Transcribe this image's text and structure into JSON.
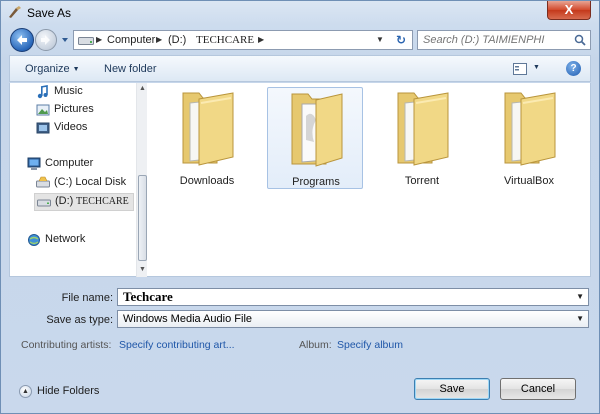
{
  "window": {
    "title": "Save As",
    "close_label": "X"
  },
  "address": {
    "crumbs": [
      "Computer",
      "(D:)",
      "TECHCARE"
    ],
    "search_placeholder": "Search (D:) TAIMIENPHI"
  },
  "toolbar": {
    "organize_label": "Organize",
    "new_folder_label": "New folder",
    "help_label": "?"
  },
  "sidebar": {
    "items": [
      {
        "label": "Music",
        "icon": "music-icon"
      },
      {
        "label": "Pictures",
        "icon": "pictures-icon"
      },
      {
        "label": "Videos",
        "icon": "videos-icon"
      },
      {
        "label": "Computer",
        "icon": "computer-icon"
      },
      {
        "label": "(C:) Local Disk",
        "icon": "drive-icon"
      },
      {
        "label": "(D:)",
        "label_suffix": "TECHCARE",
        "icon": "drive-icon"
      },
      {
        "label": "Network",
        "icon": "network-icon"
      }
    ]
  },
  "folders": [
    {
      "name": "Downloads",
      "selected": false
    },
    {
      "name": "Programs",
      "selected": true
    },
    {
      "name": "Torrent",
      "selected": false
    },
    {
      "name": "VirtualBox",
      "selected": false
    }
  ],
  "form": {
    "filename_label": "File name:",
    "filename_value": "Techcare",
    "savetype_label": "Save as type:",
    "savetype_value": "Windows Media Audio File",
    "artists_label": "Contributing artists:",
    "artists_link": "Specify contributing art...",
    "album_label": "Album:",
    "album_link": "Specify album"
  },
  "footer": {
    "hide_folders_label": "Hide Folders",
    "save_label": "Save",
    "cancel_label": "Cancel"
  },
  "colors": {
    "link": "#1f57a8",
    "folder": "#e9cf7e",
    "accent": "#2866b9"
  }
}
